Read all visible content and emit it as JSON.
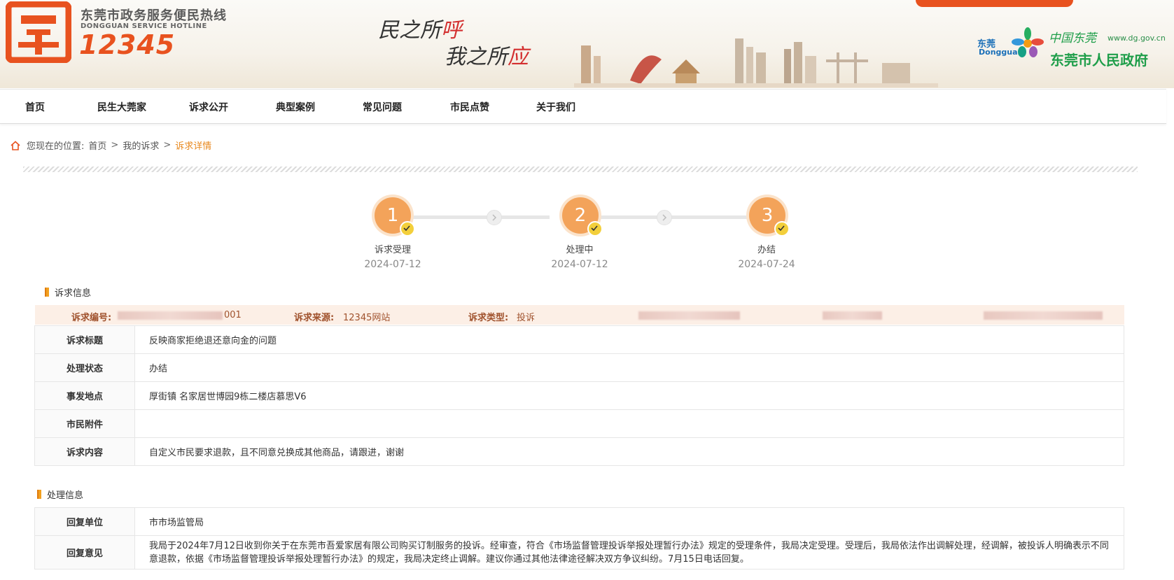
{
  "header": {
    "site_name": "东莞市政务服务便民热线",
    "site_name_en": "DONGGUAN SERVICE HOTLINE",
    "hotline": "12345",
    "slogan_1": "民之所",
    "slogan_1_accent": "呼",
    "slogan_2": "我之所",
    "slogan_2_accent": "应",
    "gov_brand_top": "东莞",
    "gov_brand_en": "Dongguan",
    "gov_calligraphy": "中国东莞",
    "gov_url": "www.dg.gov.cn",
    "gov_name": "东莞市人民政府"
  },
  "nav": {
    "items": [
      {
        "label": "首页"
      },
      {
        "label": "民生大莞家"
      },
      {
        "label": "诉求公开"
      },
      {
        "label": "典型案例"
      },
      {
        "label": "常见问题"
      },
      {
        "label": "市民点赞"
      },
      {
        "label": "关于我们"
      }
    ]
  },
  "breadcrumb": {
    "prefix": "您现在的位置:",
    "items": [
      "首页",
      "我的诉求",
      "诉求详情"
    ],
    "separator": ">"
  },
  "progress": {
    "steps": [
      {
        "num": "1",
        "label": "诉求受理",
        "date": "2024-07-12"
      },
      {
        "num": "2",
        "label": "处理中",
        "date": "2024-07-12"
      },
      {
        "num": "3",
        "label": "办结",
        "date": "2024-07-24"
      }
    ]
  },
  "request_info": {
    "section_title": "诉求信息",
    "id_label": "诉求编号:",
    "id_tail": "001",
    "source_label": "诉求来源:",
    "source_value": "12345网站",
    "type_label": "诉求类型:",
    "type_value": "投诉",
    "rows": [
      {
        "key": "诉求标题",
        "value": "反映商家拒绝退还意向金的问题"
      },
      {
        "key": "处理状态",
        "value": "办结"
      },
      {
        "key": "事发地点",
        "value": "厚街镇 名家居世博园9栋二楼店慕思V6"
      },
      {
        "key": "市民附件",
        "value": ""
      },
      {
        "key": "诉求内容",
        "value": "自定义市民要求退款，且不同意兑换成其他商品，请跟进，谢谢"
      }
    ]
  },
  "handling_info": {
    "section_title": "处理信息",
    "rows": [
      {
        "key": "回复单位",
        "value": "市市场监管局"
      },
      {
        "key": "回复意见",
        "value": "我局于2024年7月12日收到你关于在东莞市吾爱家居有限公司购买订制服务的投诉。经审查，符合《市场监督管理投诉举报处理暂行办法》规定的受理条件，我局决定受理。受理后，我局依法作出调解处理，经调解，被投诉人明确表示不同意退款，依据《市场监督管理投诉举报处理暂行办法》的规定，我局决定终止调解。建议你通过其他法律途径解决双方争议纠纷。7月15日电话回复。"
      }
    ]
  },
  "colors": {
    "accent": "#e8521f",
    "step_circle": "#f3a35a",
    "breadcrumb_current": "#e8891f",
    "info_bar_bg": "#fcefe6",
    "gov_green": "#1f9e4a"
  }
}
